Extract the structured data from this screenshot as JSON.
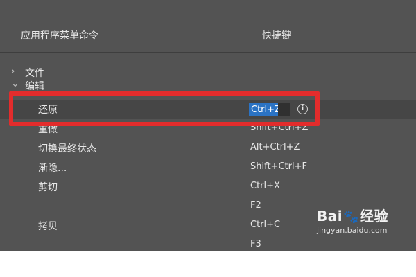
{
  "header": {
    "col_command": "应用程序菜单命令",
    "col_shortcut": "快捷键"
  },
  "groups": {
    "file": {
      "label": "文件",
      "chevron": "›"
    },
    "edit": {
      "label": "编辑",
      "chevron": "⌄"
    }
  },
  "rows": [
    {
      "label": "还原",
      "shortcut": "Ctrl+Z"
    },
    {
      "label": "重做",
      "shortcut": "Shift+Ctrl+Z"
    },
    {
      "label": "切换最终状态",
      "shortcut": "Alt+Ctrl+Z"
    },
    {
      "label": "渐隐...",
      "shortcut": "Shift+Ctrl+F"
    },
    {
      "label": "剪切",
      "shortcut": "Ctrl+X"
    },
    {
      "label": "",
      "shortcut": "F2"
    },
    {
      "label": "拷贝",
      "shortcut": "Ctrl+C"
    },
    {
      "label": "",
      "shortcut": "F3"
    }
  ],
  "icons": {
    "info": "i"
  },
  "watermark": {
    "brand_a": "Bai",
    "brand_paw": "🐾",
    "brand_b": "经验",
    "url": "jingyan.baidu.com"
  },
  "colors": {
    "panel_bg": "#535353",
    "selection": "#2b73c4",
    "highlight_box": "#e32c2c"
  }
}
